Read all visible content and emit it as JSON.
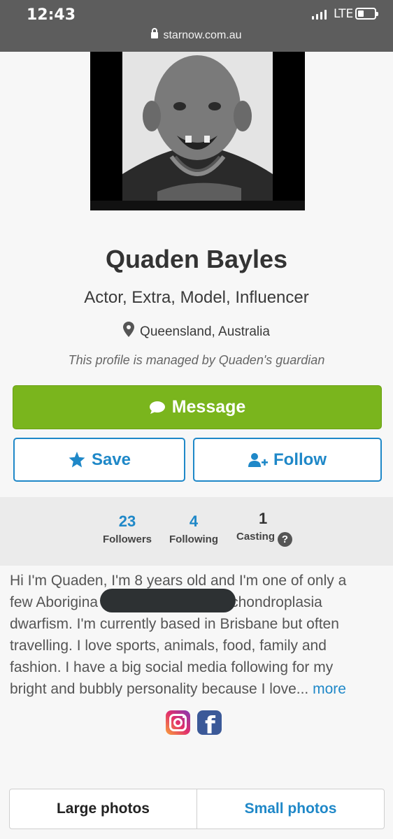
{
  "status_bar": {
    "time": "12:43",
    "network": "LTE"
  },
  "browser": {
    "url": "starnow.com.au"
  },
  "profile": {
    "name": "Quaden Bayles",
    "roles": "Actor, Extra, Model, Influencer",
    "location": "Queensland, Australia",
    "managed_note": "This profile is managed by Quaden's guardian"
  },
  "actions": {
    "message": "Message",
    "save": "Save",
    "follow": "Follow"
  },
  "stats": [
    {
      "value": "23",
      "label": "Followers"
    },
    {
      "value": "4",
      "label": "Following"
    },
    {
      "value": "1",
      "label": "Casting"
    }
  ],
  "bio": {
    "lines": [
      "Hi I'm Quaden, I'm 8 years old and I'm one of only a",
      "few Aborigina",
      "chondroplasia",
      "dwarfism. I'm currently based in Brisbane but often",
      "travelling. I love sports, animals, food, family and",
      "fashion. I have a big social media following for my",
      "bright and bubbly personality because I love..."
    ],
    "more": "more"
  },
  "tabs": {
    "large": "Large photos",
    "small": "Small photos"
  },
  "colors": {
    "green": "#7ab51d",
    "blue": "#1f88c8"
  }
}
